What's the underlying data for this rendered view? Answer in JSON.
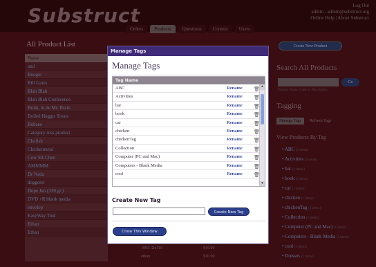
{
  "app": {
    "logo": "Substruct",
    "toplinks": [
      "Log Out",
      "admin - admin@substruct.org",
      "Online Help | About Substruct"
    ],
    "tabs": [
      {
        "label": "Orders"
      },
      {
        "label": "Products",
        "active": true
      },
      {
        "label": "Questions"
      },
      {
        "label": "Content"
      },
      {
        "label": "Users"
      }
    ]
  },
  "products": {
    "title": "All Product List",
    "column": "Name",
    "rows": [
      "and",
      "Boogie",
      "Bill Gates",
      "Blah Blah",
      "Blah Blah Conference",
      "Brain, in de Mr. Brain",
      "Boiled Haggis Treats",
      "Bubaee",
      "Category-less product",
      "Chafish",
      "Chickenmeal",
      "Cow Sil-Chee",
      "AMMMM",
      "Dr Nada",
      "doggerel",
      "Dope Jan (330 gr.)",
      "DVD +R blank media",
      "envelop",
      "EasyWay Tied",
      "Ethan",
      "Ethan"
    ],
    "bottom_rows": [
      {
        "code": "1003 -Zx110",
        "price": "$45.00"
      },
      {
        "code": "ethan",
        "price": "$16.90"
      }
    ]
  },
  "sidebar": {
    "new_product_label": "Create New Product",
    "search_title": "Search All Products",
    "search_button": "Go",
    "search_note": "Product Name, Code or Description",
    "tagging_title": "Tagging",
    "tag_tabs": [
      {
        "label": "Manage Tags",
        "active": true
      },
      {
        "label": "Refresh Tags"
      }
    ],
    "view_title": "View Products By Tag",
    "tags": [
      {
        "label": "ABC",
        "count": "(1 items)"
      },
      {
        "label": "Activities",
        "count": "(2 items)"
      },
      {
        "label": "bar",
        "count": "(1 items)"
      },
      {
        "label": "book",
        "count": "(1 items)"
      },
      {
        "label": "car",
        "count": "(1 items)"
      },
      {
        "label": "chicken",
        "count": "(1 items)"
      },
      {
        "label": "chickenTag",
        "count": "(1 items)"
      },
      {
        "label": "Collection",
        "count": "(1 items)"
      },
      {
        "label": "Computer (PC and Mac)",
        "count": "(1 items)"
      },
      {
        "label": "Computers - Blank Media",
        "count": "(1 items)"
      },
      {
        "label": "cool",
        "count": "(1 items)"
      },
      {
        "label": "Dresses",
        "count": "(2 items)"
      }
    ]
  },
  "modal": {
    "titlebar": "Manage Tags",
    "heading": "Manage Tags",
    "table_header": "Tag Name",
    "rename_label": "Rename",
    "tags": [
      "ABC",
      "Activities",
      "bar",
      "book",
      "car",
      "chicken",
      "chickenTag",
      "Collection",
      "Computer (PC and Mac)",
      "Computers - Blank Media",
      "cool"
    ],
    "create_title": "Create New Tag",
    "create_input_value": "",
    "create_button": "Create New Tag",
    "close_button": "Close This Window"
  }
}
